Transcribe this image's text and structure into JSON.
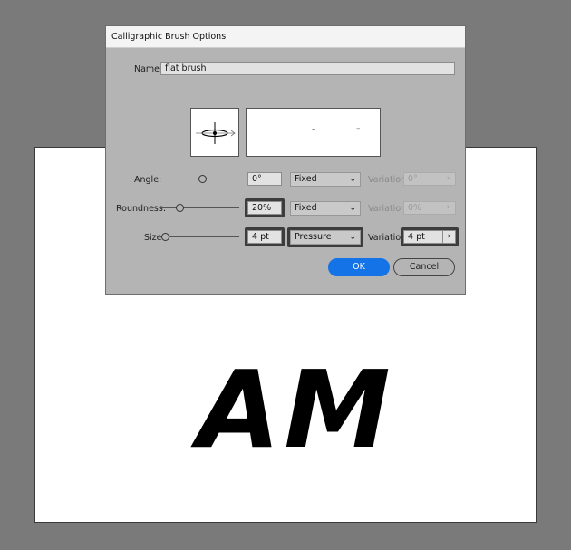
{
  "dialog": {
    "title": "Calligraphic Brush Options",
    "name_label": "Name:",
    "name_value": "flat brush",
    "angle": {
      "label": "Angle:",
      "value": "0°",
      "mode": "Fixed",
      "variation_label": "Variation:",
      "variation_value": "0°"
    },
    "roundness": {
      "label": "Roundness:",
      "value": "20%",
      "mode": "Fixed",
      "variation_label": "Variation:",
      "variation_value": "0%"
    },
    "size": {
      "label": "Size:",
      "value": "4 pt",
      "mode": "Pressure",
      "variation_label": "Variation:",
      "variation_value": "4 pt"
    },
    "ok_label": "OK",
    "cancel_label": "Cancel",
    "preview_dashes": [
      "-",
      "–"
    ]
  },
  "artboard": {
    "text": "AM"
  },
  "colors": {
    "ok_button": "#1473e6",
    "background": "#7a7a7a",
    "dialog": "#b4b4b4",
    "highlight": "#3c3c3c"
  },
  "icons": {
    "dropdown": "chevron-down-icon",
    "variation_arrow": "chevron-right-icon"
  }
}
